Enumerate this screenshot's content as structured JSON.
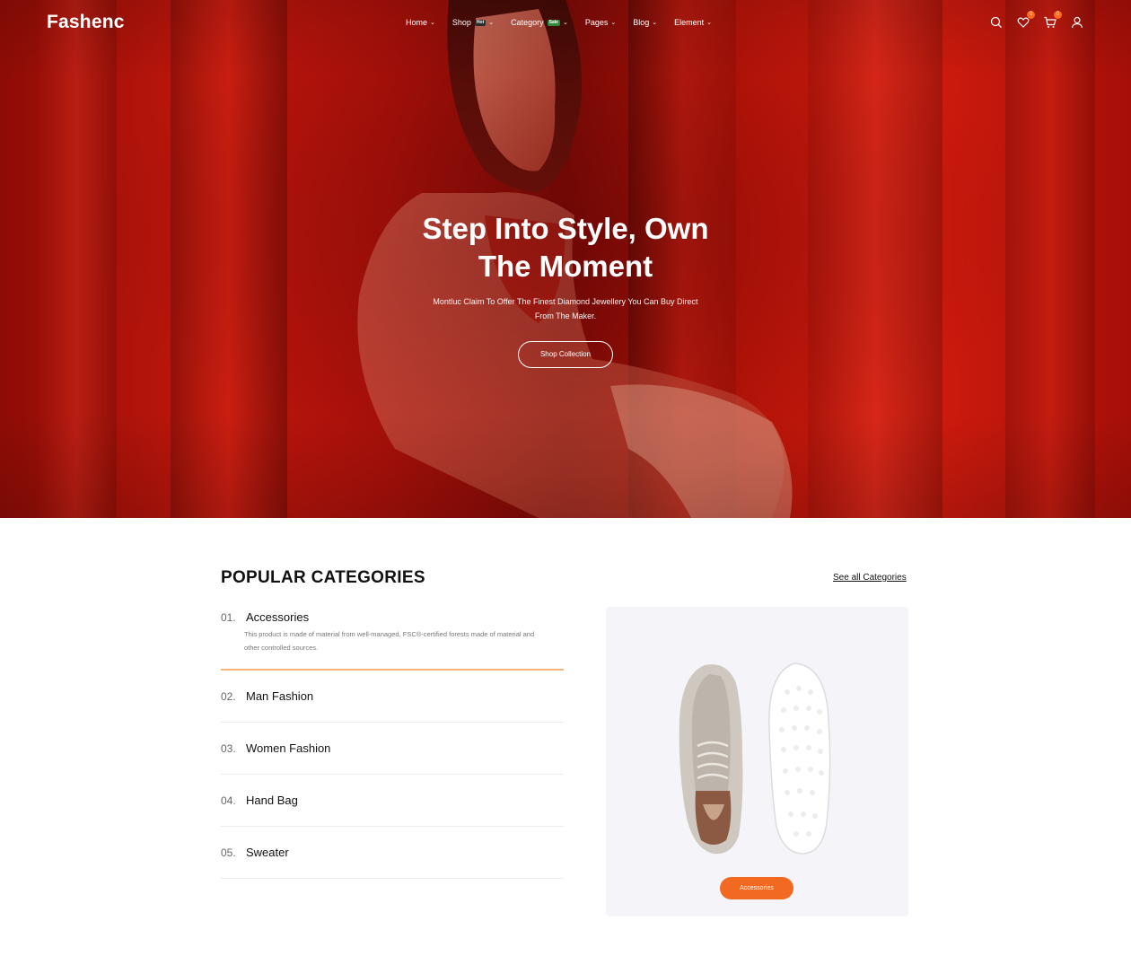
{
  "header": {
    "logo": "Fashenc",
    "nav": [
      {
        "label": "Home",
        "badge": null
      },
      {
        "label": "Shop",
        "badge": "Hot",
        "badge_color": "#2b2b2b"
      },
      {
        "label": "Category",
        "badge": "Sale",
        "badge_color": "#2d8a3a"
      },
      {
        "label": "Pages",
        "badge": null
      },
      {
        "label": "Blog",
        "badge": null
      },
      {
        "label": "Element",
        "badge": null
      }
    ],
    "icons": {
      "search": "search-icon",
      "wishlist": "heart-icon",
      "wishlist_count": "0",
      "cart": "cart-icon",
      "cart_count": "0",
      "account": "user-icon"
    }
  },
  "hero": {
    "title": "Step Into Style, Own The Moment",
    "subtitle": "Montluc Claim To Offer The Finest Diamond Jewellery You Can Buy Direct From The Maker.",
    "cta": "Shop Collection"
  },
  "categories": {
    "title": "POPULAR CATEGORIES",
    "see_all": "See all Categories",
    "items": [
      {
        "num": "01.",
        "name": "Accessories",
        "desc": "This product is made of material from well-managed, FSC®-certified forests made of material and other controlled sources."
      },
      {
        "num": "02.",
        "name": "Man Fashion"
      },
      {
        "num": "03.",
        "name": "Women Fashion"
      },
      {
        "num": "04.",
        "name": "Hand Bag"
      },
      {
        "num": "05.",
        "name": "Sweater"
      }
    ],
    "promo_button": "Accessories"
  },
  "colors": {
    "accent": "#f26a21",
    "hero_red": "#b81409"
  }
}
